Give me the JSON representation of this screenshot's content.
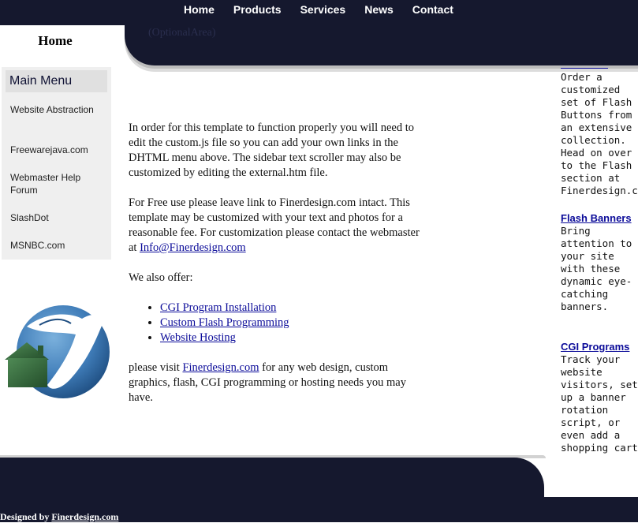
{
  "nav": {
    "items": [
      {
        "label": "Home"
      },
      {
        "label": "Products"
      },
      {
        "label": "Services"
      },
      {
        "label": "News"
      },
      {
        "label": "Contact"
      }
    ]
  },
  "home_tab": {
    "label": "Home"
  },
  "optional_area": "(OptionalArea)",
  "sidebar": {
    "title": "Main Menu",
    "items": [
      {
        "label": "Website Abstraction"
      },
      {
        "label": "Freewarejava.com"
      },
      {
        "label": "Webmaster Help Forum"
      },
      {
        "label": "SlashDot"
      },
      {
        "label": "MSNBC.com"
      }
    ]
  },
  "main": {
    "p1": "In order for this template to function properly you will need to edit the custom.js file so you can add your own links in the DHTML menu above. The sidebar text scroller may also be customized by editing the external.htm file.",
    "p2_text": "For Free use please leave link to Finerdesign.com intact. This template may be customized with your text and photos for a reasonable fee. For customization please contact the webmaster at ",
    "p2_email": "Info@Finerdesign.com",
    "p3": "We also offer:",
    "offers": [
      "CGI Program Installation",
      "Custom Flash Programming",
      "Website Hosting"
    ],
    "p4_pre": "please visit ",
    "p4_link": "Finerdesign.com",
    "p4_post": " for any web design, custom graphics, flash, CGI programming or hosting needs you may have."
  },
  "scroller": {
    "block1_text": "Order a customized set of Flash Buttons from an extensive collection. Head on over to the Flash section at Finerdesign.com",
    "block2_title": "Flash Banners",
    "block2_text": "Bring attention to your site with these dynamic eye-catching banners.",
    "block3_title": "CGI Programs",
    "block3_text": "Track your website visitors, set up a banner rotation script, or even add a shopping cart"
  },
  "footer": {
    "credit_prefix": "Designed by ",
    "credit_link": "Finerdesign.com"
  },
  "colors": {
    "navy": "#15182e",
    "link": "#0b0b99",
    "menu_bg": "#efefef"
  }
}
